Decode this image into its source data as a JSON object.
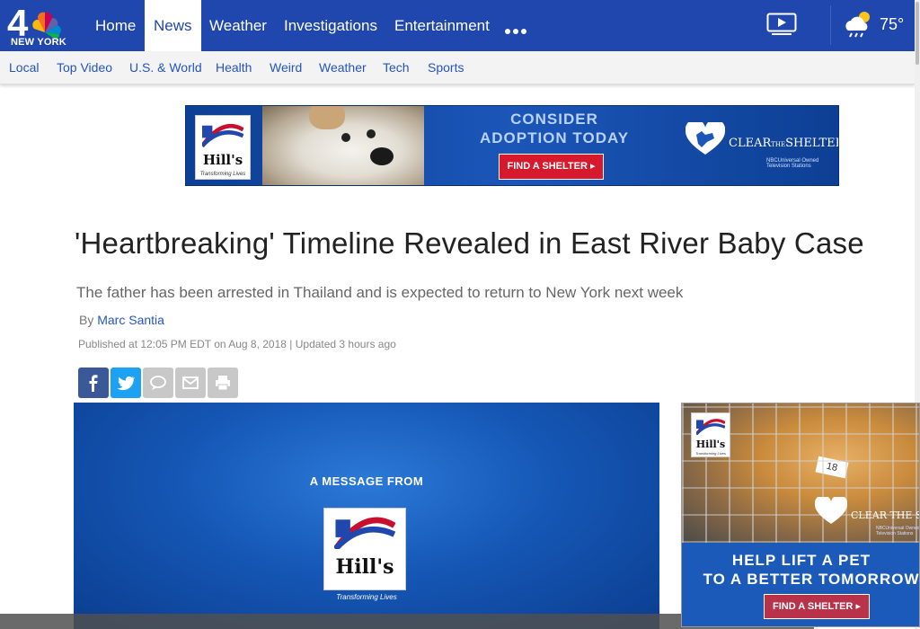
{
  "header": {
    "logo_text": "NEW YORK",
    "logo_number": "4",
    "nav": [
      {
        "label": "Home",
        "active": false
      },
      {
        "label": "News",
        "active": true
      },
      {
        "label": "Weather",
        "active": false
      },
      {
        "label": "Investigations",
        "active": false
      },
      {
        "label": "Entertainment",
        "active": false
      }
    ],
    "more_icon": "more-dots-icon",
    "video_icon": "video-play-icon",
    "weather_icon": "partly-cloudy-rain-icon",
    "temperature": "75°"
  },
  "subnav": [
    "Local",
    "Top Video",
    "U.S. & World",
    "Health",
    "Weird",
    "Weather",
    "Tech",
    "Sports"
  ],
  "ad_top": {
    "brand": "Hill's",
    "brand_tagline": "Transforming Lives",
    "headline_1": "CONSIDER",
    "headline_2": "ADOPTION TODAY",
    "button": "FIND A SHELTER ▸",
    "partner_1": "CLEAR",
    "partner_2": "THE",
    "partner_3": "SHELTERS",
    "partner_sub": "NBCUniversal Owned Television Stations"
  },
  "article": {
    "headline": "'Heartbreaking' Timeline Revealed in East River Baby Case",
    "dek": "The father has been arrested in Thailand and is expected to return to New York next week",
    "by_prefix": "By",
    "author": "Marc Santia",
    "dateline": "Published at 12:05 PM EDT on Aug 8, 2018 | Updated 3 hours ago"
  },
  "share_buttons": [
    {
      "icon": "facebook-icon",
      "color": "#3b5998"
    },
    {
      "icon": "twitter-icon",
      "color": "#1da1f2"
    },
    {
      "icon": "comment-icon",
      "color": "#c8c8c8"
    },
    {
      "icon": "email-icon",
      "color": "#c8c8c8"
    },
    {
      "icon": "print-icon",
      "color": "#c8c8c8"
    }
  ],
  "video": {
    "message_from": "A MESSAGE FROM",
    "brand": "Hill's",
    "brand_tagline": "Transforming Lives"
  },
  "ad_right": {
    "brand": "Hill's",
    "brand_tagline": "Transforming Lives",
    "tag_number": "18",
    "headline_1": "HELP LIFT A PET",
    "headline_2": "TO A BETTER TOMORROW",
    "button": "FIND A SHELTER ▸",
    "partner": "CLEAR THE SHELT",
    "partner_sub": "NBCUniversal Owned Television Stations"
  },
  "colors": {
    "brand_blue": "#1f47ad",
    "link_blue": "#2554c1",
    "ad_red": "#d7192e"
  }
}
